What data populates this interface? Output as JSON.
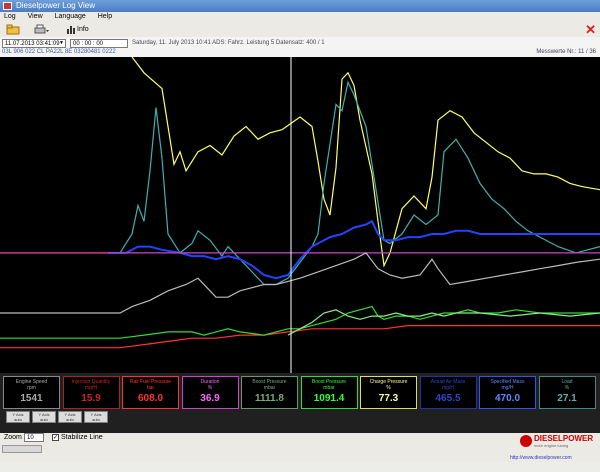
{
  "window": {
    "title": "Dieselpower Log View"
  },
  "menu": [
    "Log",
    "View",
    "Language",
    "Help"
  ],
  "toolbar": {
    "open_label": "",
    "print_label": "",
    "chart_label": "Info"
  },
  "info": {
    "date_value": "11.07.2013 03:41:09",
    "time_value": "00 : 00 : 00",
    "line1": "Saturday, 11. July 2013   10:41   ADS: Fahrz. Leistung 5       Datensatz: 400 / 1",
    "line2": "03L 906 022 CL   PA22L 8E   03280481 0222",
    "right_text": "Messwerte Nr.: 11 / 36"
  },
  "chart_data": {
    "type": "line",
    "cursor_x": 0.485,
    "series": [
      {
        "color": "#ffff66",
        "points": [
          [
            0.22,
            0.0
          ],
          [
            0.24,
            0.05
          ],
          [
            0.27,
            0.1
          ],
          [
            0.28,
            0.22
          ],
          [
            0.29,
            0.34
          ],
          [
            0.3,
            0.3
          ],
          [
            0.31,
            0.36
          ],
          [
            0.33,
            0.3
          ],
          [
            0.35,
            0.28
          ],
          [
            0.37,
            0.31
          ],
          [
            0.39,
            0.25
          ],
          [
            0.41,
            0.22
          ],
          [
            0.43,
            0.26
          ],
          [
            0.45,
            0.24
          ],
          [
            0.47,
            0.23
          ],
          [
            0.5,
            0.19
          ],
          [
            0.52,
            0.22
          ],
          [
            0.53,
            0.33
          ],
          [
            0.54,
            0.45
          ],
          [
            0.55,
            0.5
          ],
          [
            0.56,
            0.35
          ],
          [
            0.57,
            0.07
          ],
          [
            0.58,
            0.05
          ],
          [
            0.59,
            0.09
          ],
          [
            0.6,
            0.2
          ],
          [
            0.62,
            0.37
          ],
          [
            0.63,
            0.52
          ],
          [
            0.64,
            0.66
          ],
          [
            0.65,
            0.62
          ],
          [
            0.67,
            0.48
          ],
          [
            0.69,
            0.44
          ],
          [
            0.71,
            0.48
          ],
          [
            0.72,
            0.38
          ],
          [
            0.73,
            0.2
          ],
          [
            0.75,
            0.17
          ],
          [
            0.77,
            0.19
          ],
          [
            0.79,
            0.24
          ],
          [
            0.81,
            0.27
          ],
          [
            0.83,
            0.3
          ],
          [
            0.85,
            0.32
          ],
          [
            0.87,
            0.36
          ],
          [
            0.89,
            0.37
          ],
          [
            0.91,
            0.37
          ],
          [
            0.93,
            0.38
          ],
          [
            0.95,
            0.4
          ],
          [
            0.97,
            0.41
          ],
          [
            1.0,
            0.42
          ]
        ]
      },
      {
        "color": "#40b0b0",
        "points": [
          [
            0.0,
            0.62
          ],
          [
            0.2,
            0.62
          ],
          [
            0.22,
            0.56
          ],
          [
            0.23,
            0.47
          ],
          [
            0.24,
            0.52
          ],
          [
            0.25,
            0.36
          ],
          [
            0.26,
            0.16
          ],
          [
            0.27,
            0.32
          ],
          [
            0.28,
            0.56
          ],
          [
            0.3,
            0.62
          ],
          [
            0.32,
            0.59
          ],
          [
            0.33,
            0.55
          ],
          [
            0.35,
            0.58
          ],
          [
            0.37,
            0.63
          ],
          [
            0.38,
            0.6
          ],
          [
            0.4,
            0.64
          ],
          [
            0.42,
            0.68
          ],
          [
            0.44,
            0.72
          ],
          [
            0.46,
            0.72
          ],
          [
            0.48,
            0.7
          ],
          [
            0.5,
            0.65
          ],
          [
            0.52,
            0.6
          ],
          [
            0.53,
            0.56
          ],
          [
            0.54,
            0.4
          ],
          [
            0.56,
            0.15
          ],
          [
            0.57,
            0.17
          ],
          [
            0.58,
            0.08
          ],
          [
            0.59,
            0.12
          ],
          [
            0.61,
            0.22
          ],
          [
            0.63,
            0.46
          ],
          [
            0.64,
            0.58
          ],
          [
            0.65,
            0.59
          ],
          [
            0.67,
            0.56
          ],
          [
            0.69,
            0.5
          ],
          [
            0.71,
            0.53
          ],
          [
            0.73,
            0.5
          ],
          [
            0.74,
            0.3
          ],
          [
            0.76,
            0.26
          ],
          [
            0.78,
            0.32
          ],
          [
            0.8,
            0.4
          ],
          [
            0.82,
            0.45
          ],
          [
            0.84,
            0.48
          ],
          [
            0.86,
            0.52
          ],
          [
            0.88,
            0.55
          ],
          [
            0.9,
            0.57
          ],
          [
            0.93,
            0.6
          ],
          [
            0.96,
            0.62
          ],
          [
            1.0,
            0.6
          ]
        ]
      },
      {
        "color": "#2244ff",
        "points": [
          [
            0.0,
            0.62
          ],
          [
            0.21,
            0.62
          ],
          [
            0.23,
            0.6
          ],
          [
            0.25,
            0.6
          ],
          [
            0.27,
            0.61
          ],
          [
            0.3,
            0.62
          ],
          [
            0.32,
            0.63
          ],
          [
            0.34,
            0.63
          ],
          [
            0.36,
            0.64
          ],
          [
            0.38,
            0.63
          ],
          [
            0.4,
            0.64
          ],
          [
            0.42,
            0.66
          ],
          [
            0.44,
            0.69
          ],
          [
            0.46,
            0.7
          ],
          [
            0.48,
            0.69
          ],
          [
            0.5,
            0.64
          ],
          [
            0.52,
            0.6
          ],
          [
            0.54,
            0.58
          ],
          [
            0.55,
            0.57
          ],
          [
            0.57,
            0.56
          ],
          [
            0.59,
            0.54
          ],
          [
            0.61,
            0.53
          ],
          [
            0.62,
            0.52
          ],
          [
            0.63,
            0.56
          ],
          [
            0.64,
            0.58
          ],
          [
            0.66,
            0.58
          ],
          [
            0.68,
            0.57
          ],
          [
            0.7,
            0.57
          ],
          [
            0.72,
            0.56
          ],
          [
            0.74,
            0.56
          ],
          [
            0.76,
            0.55
          ],
          [
            0.78,
            0.55
          ],
          [
            0.8,
            0.56
          ],
          [
            0.83,
            0.56
          ],
          [
            0.86,
            0.56
          ],
          [
            0.89,
            0.56
          ],
          [
            0.92,
            0.56
          ],
          [
            0.95,
            0.56
          ],
          [
            1.0,
            0.56
          ]
        ]
      },
      {
        "color": "#cc44cc",
        "points": [
          [
            0.0,
            0.62
          ],
          [
            1.0,
            0.62
          ]
        ]
      },
      {
        "color": "#dd2222",
        "points": [
          [
            0.0,
            0.62
          ],
          [
            0.18,
            0.62
          ]
        ]
      },
      {
        "color": "#bbbbbb",
        "points": [
          [
            0.0,
            0.81
          ],
          [
            0.2,
            0.81
          ],
          [
            0.22,
            0.79
          ],
          [
            0.25,
            0.77
          ],
          [
            0.28,
            0.74
          ],
          [
            0.31,
            0.72
          ],
          [
            0.33,
            0.7
          ],
          [
            0.35,
            0.74
          ],
          [
            0.36,
            0.76
          ],
          [
            0.38,
            0.76
          ],
          [
            0.4,
            0.74
          ],
          [
            0.42,
            0.73
          ],
          [
            0.44,
            0.72
          ],
          [
            0.46,
            0.72
          ],
          [
            0.48,
            0.71
          ],
          [
            0.5,
            0.7
          ],
          [
            0.53,
            0.68
          ],
          [
            0.56,
            0.66
          ],
          [
            0.59,
            0.64
          ],
          [
            0.61,
            0.62
          ],
          [
            0.63,
            0.67
          ],
          [
            0.65,
            0.69
          ],
          [
            0.67,
            0.7
          ],
          [
            0.7,
            0.69
          ],
          [
            0.72,
            0.64
          ],
          [
            0.73,
            0.67
          ],
          [
            0.75,
            0.72
          ],
          [
            0.78,
            0.71
          ],
          [
            0.81,
            0.7
          ],
          [
            0.84,
            0.69
          ],
          [
            0.87,
            0.68
          ],
          [
            0.9,
            0.67
          ],
          [
            0.93,
            0.66
          ],
          [
            0.96,
            0.65
          ],
          [
            1.0,
            0.64
          ]
        ]
      },
      {
        "color": "#ff3333",
        "points": [
          [
            0.0,
            0.92
          ],
          [
            0.2,
            0.92
          ],
          [
            0.24,
            0.91
          ],
          [
            0.28,
            0.9
          ],
          [
            0.32,
            0.89
          ],
          [
            0.36,
            0.89
          ],
          [
            0.4,
            0.88
          ],
          [
            0.44,
            0.88
          ],
          [
            0.48,
            0.87
          ],
          [
            0.52,
            0.86
          ],
          [
            0.56,
            0.86
          ],
          [
            0.6,
            0.86
          ],
          [
            0.64,
            0.86
          ],
          [
            0.68,
            0.85
          ],
          [
            0.72,
            0.85
          ],
          [
            0.76,
            0.85
          ],
          [
            0.8,
            0.85
          ],
          [
            0.85,
            0.85
          ],
          [
            0.9,
            0.85
          ],
          [
            0.95,
            0.85
          ],
          [
            1.0,
            0.85
          ]
        ]
      },
      {
        "color": "#33dd33",
        "points": [
          [
            0.0,
            0.89
          ],
          [
            0.2,
            0.89
          ],
          [
            0.24,
            0.88
          ],
          [
            0.28,
            0.87
          ],
          [
            0.32,
            0.87
          ],
          [
            0.34,
            0.88
          ],
          [
            0.36,
            0.87
          ],
          [
            0.38,
            0.86
          ],
          [
            0.4,
            0.87
          ],
          [
            0.44,
            0.88
          ],
          [
            0.46,
            0.87
          ],
          [
            0.48,
            0.86
          ],
          [
            0.5,
            0.86
          ],
          [
            0.52,
            0.85
          ],
          [
            0.54,
            0.84
          ],
          [
            0.56,
            0.83
          ],
          [
            0.58,
            0.81
          ],
          [
            0.6,
            0.8
          ],
          [
            0.62,
            0.79
          ],
          [
            0.63,
            0.82
          ],
          [
            0.64,
            0.83
          ],
          [
            0.66,
            0.82
          ],
          [
            0.68,
            0.82
          ],
          [
            0.7,
            0.83
          ],
          [
            0.72,
            0.82
          ],
          [
            0.74,
            0.81
          ],
          [
            0.76,
            0.81
          ],
          [
            0.78,
            0.8
          ],
          [
            0.8,
            0.81
          ],
          [
            0.83,
            0.81
          ],
          [
            0.86,
            0.8
          ],
          [
            0.9,
            0.81
          ],
          [
            0.94,
            0.81
          ],
          [
            0.97,
            0.81
          ],
          [
            1.0,
            0.81
          ]
        ]
      },
      {
        "color": "#88ee88",
        "points": [
          [
            0.48,
            0.88
          ],
          [
            0.5,
            0.86
          ],
          [
            0.52,
            0.84
          ],
          [
            0.54,
            0.81
          ],
          [
            0.56,
            0.8
          ],
          [
            0.58,
            0.82
          ],
          [
            0.6,
            0.83
          ],
          [
            0.62,
            0.82
          ],
          [
            0.64,
            0.82
          ],
          [
            0.66,
            0.81
          ],
          [
            0.68,
            0.82
          ],
          [
            0.7,
            0.82
          ],
          [
            0.72,
            0.81
          ],
          [
            0.74,
            0.82
          ],
          [
            0.76,
            0.81
          ],
          [
            0.8,
            0.81
          ],
          [
            0.85,
            0.82
          ],
          [
            0.9,
            0.81
          ],
          [
            0.95,
            0.82
          ],
          [
            1.0,
            0.81
          ]
        ]
      }
    ]
  },
  "gauges": [
    {
      "label": "Engine Speed\nrpm",
      "value": "1541",
      "color": "#aaaaaa",
      "border": "#888888"
    },
    {
      "label": "Injection Quantity\nmg/H",
      "value": "15.9",
      "color": "#cc2222",
      "border": "#aa2222"
    },
    {
      "label": "Rail Fuel Pressure\nbar",
      "value": "608.0",
      "color": "#ff3333",
      "border": "#ff3333"
    },
    {
      "label": "Duration\n%",
      "value": "36.9",
      "color": "#ff66ff",
      "border": "#cc44cc"
    },
    {
      "label": "Boost Pressure\nmbar",
      "value": "1111.8",
      "color": "#77aa77",
      "border": "#669966"
    },
    {
      "label": "Boost Pressure\nmbar",
      "value": "1091.4",
      "color": "#33ff33",
      "border": "#33dd33"
    },
    {
      "label": "Charge Pressure\n%",
      "value": "77.3",
      "color": "#ffff99",
      "border": "#dddd66"
    },
    {
      "label": "Actual Air Mass\nmg/H",
      "value": "465.5",
      "color": "#3344cc",
      "border": "#2233aa"
    },
    {
      "label": "Specified Mass\nmg/H",
      "value": "470.0",
      "color": "#6688ff",
      "border": "#3355ee"
    },
    {
      "label": "Load\n%",
      "value": "27.1",
      "color": "#66aaaa",
      "border": "#448888"
    }
  ],
  "axis_buttons": [
    "Y Axis\nauto",
    "Y Axis\nauto",
    "Y Axis\nauto",
    "Y Axis\nauto"
  ],
  "bottom": {
    "zoom_label": "Zoom",
    "zoom_value": "10",
    "checkbox_label": "Stabilize Line",
    "logo_text": "DIESELPOWER",
    "logo_sub": "more engine tuning",
    "url": "http://www.dieselpower.com"
  }
}
